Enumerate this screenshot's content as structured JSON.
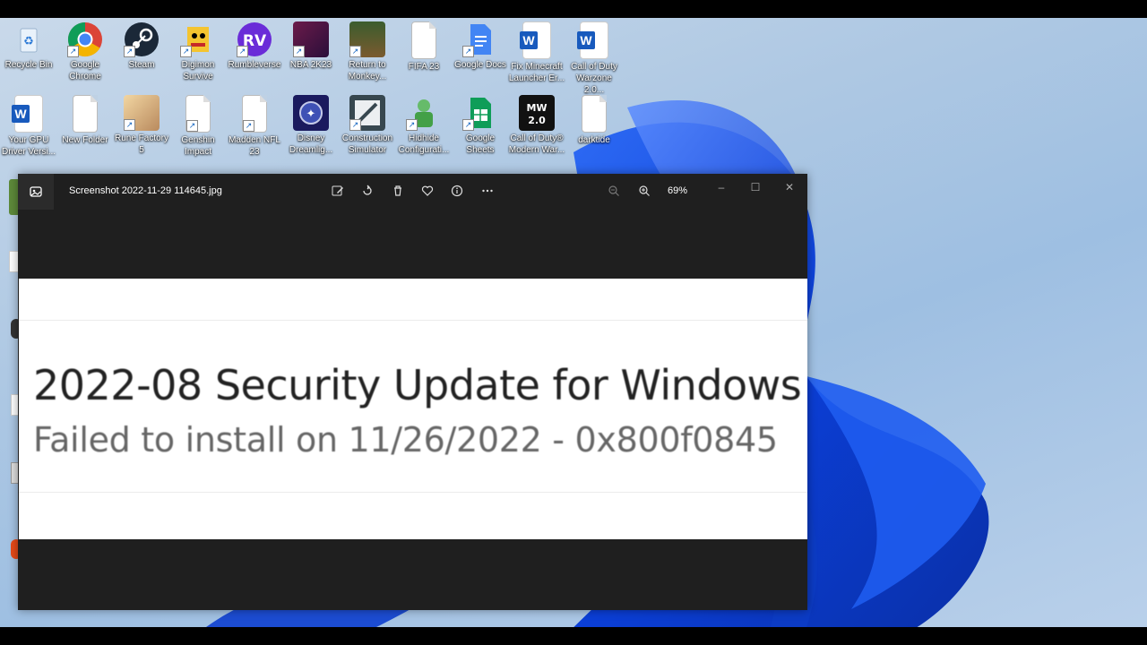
{
  "desktop": {
    "row1": [
      {
        "label": "Recycle Bin",
        "icon": "recycle-bin-icon"
      },
      {
        "label": "Google Chrome",
        "icon": "chrome-icon"
      },
      {
        "label": "Steam",
        "icon": "steam-icon"
      },
      {
        "label": "Digimon Survive",
        "icon": "digimon-icon"
      },
      {
        "label": "Rumbleverse",
        "icon": "rumbleverse-icon"
      },
      {
        "label": "NBA 2K23",
        "icon": "nba2k23-icon"
      },
      {
        "label": "Return to Monkey...",
        "icon": "monkey-island-icon"
      },
      {
        "label": "FIFA 23",
        "icon": "file-icon"
      },
      {
        "label": "Google Docs",
        "icon": "google-docs-icon"
      },
      {
        "label": "Fix Minecraft Launcher Er...",
        "icon": "word-doc-icon"
      },
      {
        "label": "Call of Duty Warzone 2.0...",
        "icon": "word-doc-icon"
      }
    ],
    "row2": [
      {
        "label": "Your GPU Driver Versi...",
        "icon": "word-doc-icon"
      },
      {
        "label": "New Folder",
        "icon": "file-icon"
      },
      {
        "label": "Rune Factory 5",
        "icon": "rune-factory-icon"
      },
      {
        "label": "Genshin Impact",
        "icon": "file-icon"
      },
      {
        "label": "Madden NFL 23",
        "icon": "file-icon"
      },
      {
        "label": "Disney Dreamlig...",
        "icon": "disney-icon"
      },
      {
        "label": "Construction Simulator",
        "icon": "construction-icon"
      },
      {
        "label": "Hidhide Configurati...",
        "icon": "hidhide-icon"
      },
      {
        "label": "Google Sheets",
        "icon": "google-sheets-icon"
      },
      {
        "label": "Call of Duty® Modern War...",
        "icon": "mw2-icon"
      },
      {
        "label": "darktide",
        "icon": "file-icon"
      }
    ]
  },
  "viewer": {
    "filename": "Screenshot 2022-11-29 114645.jpg",
    "zoom": "69%",
    "toolbar": {
      "edit": "edit-icon",
      "rotate": "rotate-icon",
      "delete": "delete-icon",
      "favorite": "heart-icon",
      "info": "info-icon",
      "more": "more-icon",
      "zoom_out": "zoom-out-icon",
      "zoom_in": "zoom-in-icon"
    }
  },
  "image_content": {
    "title": "2022-08 Security Update for Windows",
    "status": "Failed to install on 11/26/2022 - 0x800f0845"
  },
  "colors": {
    "window_bg": "#1f1f1f",
    "accent_blue": "#0a4fe0"
  }
}
